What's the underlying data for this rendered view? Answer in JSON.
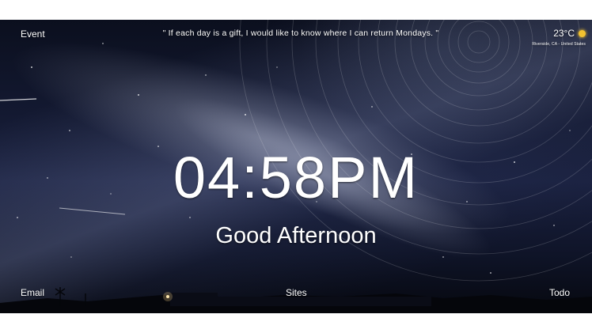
{
  "top_bar": {
    "event_label": "Event",
    "quote": "\" If each day is a gift, I would like to know where I can return Mondays. \""
  },
  "weather": {
    "temperature": "23°C",
    "icon": "sun-icon",
    "location": "Riverside, CA - United States"
  },
  "clock": {
    "time": "04:58PM",
    "greeting": "Good Afternoon"
  },
  "bottom_bar": {
    "email_label": "Email",
    "sites_label": "Sites",
    "todo_label": "Todo"
  },
  "colors": {
    "text": "#ffffff",
    "sun": "#f2c230",
    "sky_dark": "#0b0f1e"
  }
}
